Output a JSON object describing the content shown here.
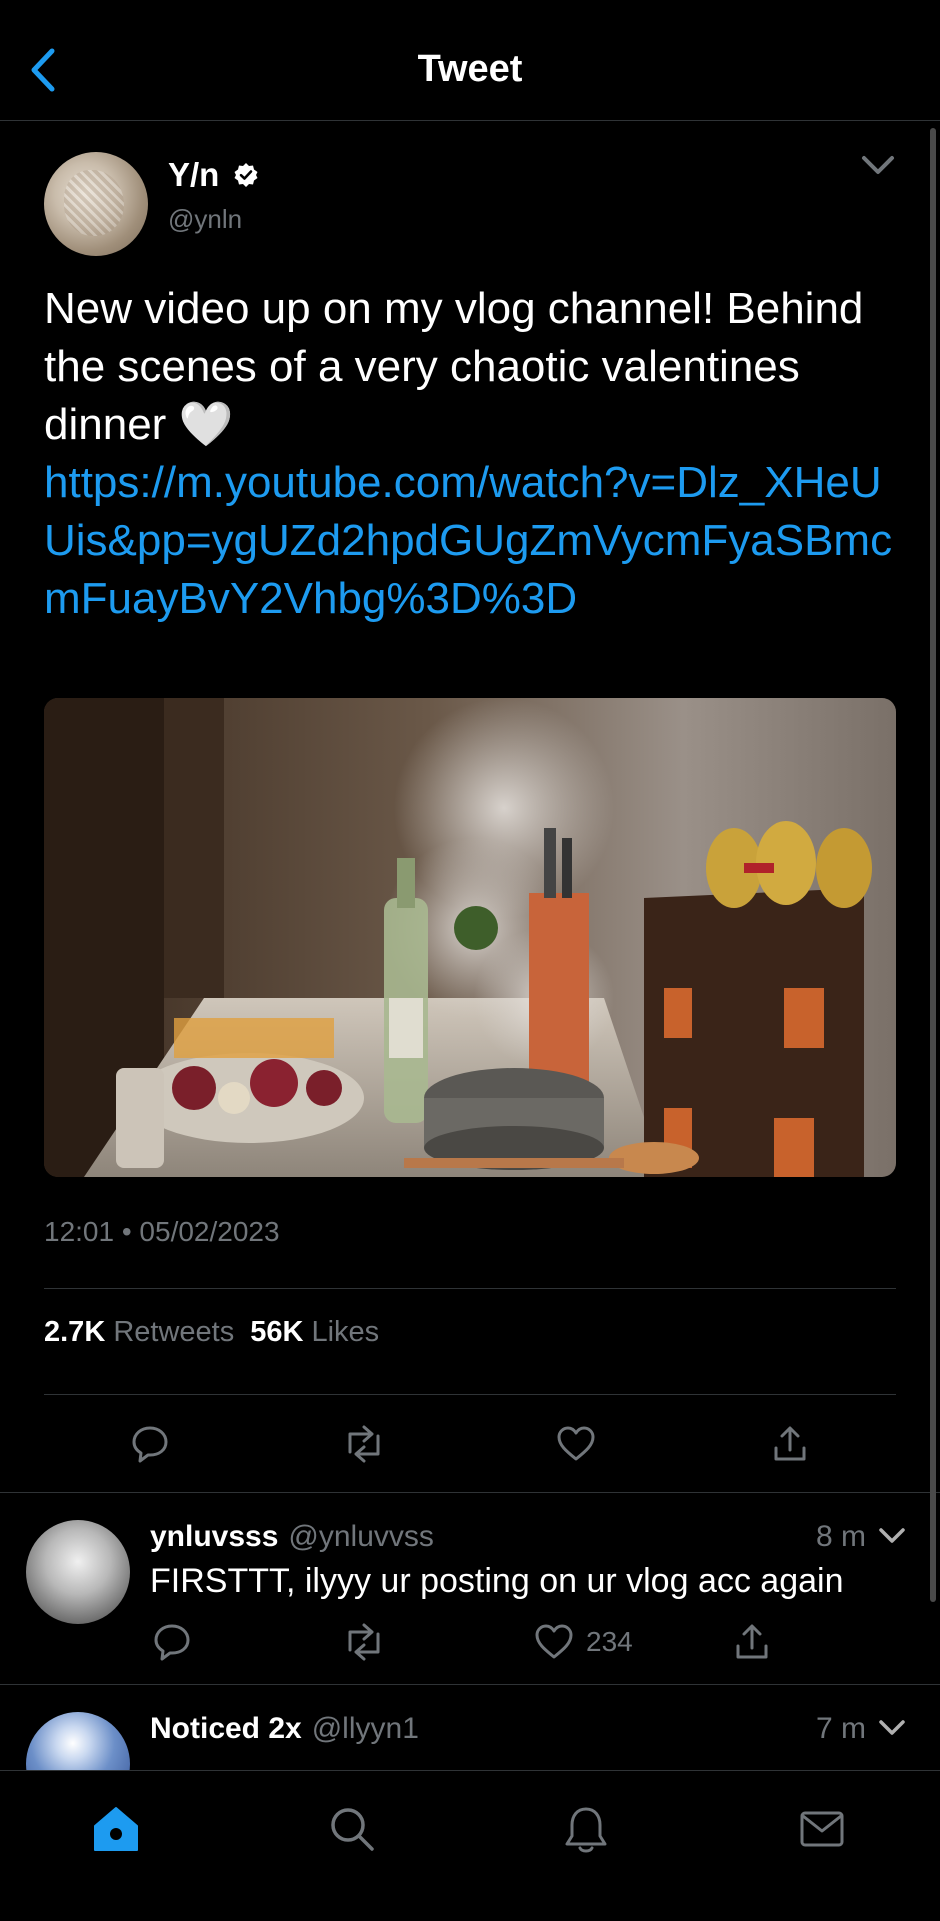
{
  "header": {
    "title": "Tweet"
  },
  "tweet": {
    "author_name": "Y/n",
    "author_handle": "@ynln",
    "text": "New video up on my vlog channel! Behind the scenes of a very chaotic valentines dinner 🤍",
    "link": "https://m.youtube.com/watch?v=Dlz_XHeUUis&pp=ygUZd2hpdGUgZmVycmFyaSBmcmFuayBvY2Vhbg%3D%3D",
    "timestamp": "12:01 • 05/02/2023",
    "retweets_count": "2.7K",
    "retweets_label": "Retweets",
    "likes_count": "56K",
    "likes_label": "Likes"
  },
  "replies": [
    {
      "name": "ynluvsss",
      "handle": "@ynluvvss",
      "time": "8 m",
      "text": "FIRSTTT, ilyyy ur posting on ur vlog acc again",
      "likes": "234"
    },
    {
      "name": "Noticed 2x",
      "handle": "@llyyn1",
      "time": "7 m"
    }
  ],
  "colors": {
    "background": "#000000",
    "accent": "#1d9bf0",
    "secondary_text": "#71767b",
    "divider": "#2f3336"
  },
  "icons": {
    "back": "chevron-left-icon",
    "verified": "verified-badge-icon",
    "more": "chevron-down-icon",
    "reply": "reply-icon",
    "retweet": "retweet-icon",
    "like": "heart-icon",
    "share": "share-icon",
    "home": "home-icon",
    "search": "search-icon",
    "notifications": "bell-icon",
    "messages": "mail-icon"
  }
}
